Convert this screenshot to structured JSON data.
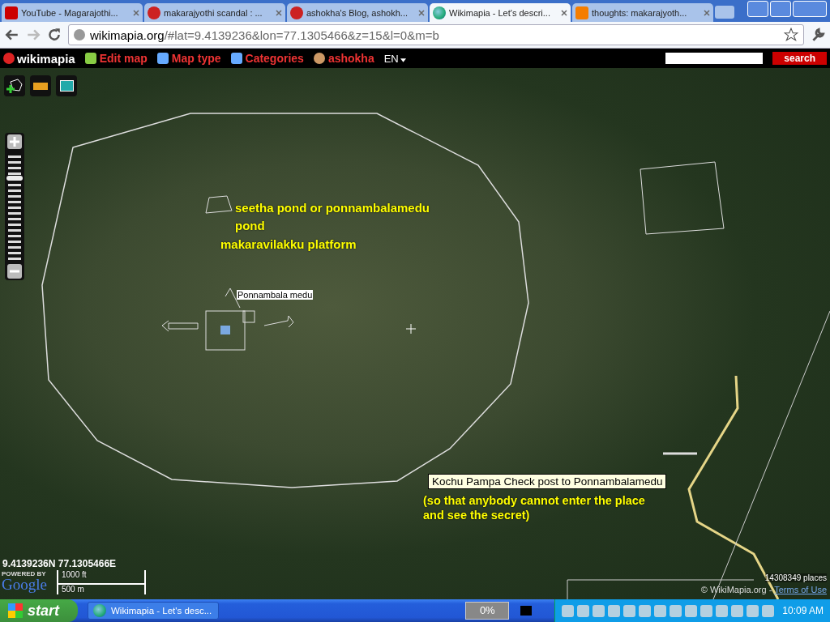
{
  "browser": {
    "tabs": [
      {
        "title": "YouTube - Magarajothi...",
        "selected": false
      },
      {
        "title": "makarajyothi scandal : ...",
        "selected": false
      },
      {
        "title": "ashokha's Blog, ashokh...",
        "selected": false
      },
      {
        "title": "Wikimapia - Let's descri...",
        "selected": true
      },
      {
        "title": "thoughts: makarajyoth...",
        "selected": false
      }
    ],
    "url_host": "wikimapia.org",
    "url_rest": "/#lat=9.4139236&lon=77.1305466&z=15&l=0&m=b"
  },
  "toolbar": {
    "logo": "wikimapia",
    "items": [
      "Edit map",
      "Map type",
      "Categories",
      "ashokha"
    ],
    "language": "EN",
    "search_button": "search"
  },
  "map": {
    "zoom": {
      "level": 0.78
    },
    "labels": [
      {
        "kind": "note",
        "text": "seetha pond or ponnambalamedu pond"
      },
      {
        "kind": "note",
        "text": "makaravilakku platform"
      },
      {
        "kind": "place",
        "text": "Ponnambala medu"
      },
      {
        "kind": "tooltip",
        "text": "Kochu Pampa Check post to Ponnambalamedu"
      },
      {
        "kind": "note",
        "text": "(so that anybody cannot enter the place and see the secret)"
      }
    ],
    "coordinates": "9.4139236N 77.1305466E",
    "powered_by": "POWERED BY",
    "google": "Google",
    "scale_ft": "1000 ft",
    "scale_m": "500 m",
    "places": "14308349 places",
    "copyright": "© WikiMapia.org - ",
    "terms": "Terms of Use"
  },
  "taskbar": {
    "start": "start",
    "window": "Wikimapia - Let's desc...",
    "battery": "0%",
    "time": "10:09 AM"
  }
}
